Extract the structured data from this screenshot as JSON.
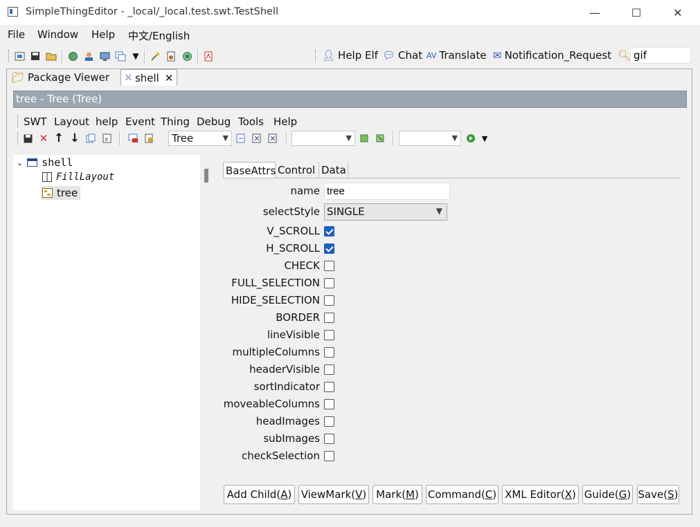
{
  "window": {
    "title": "SimpleThingEditor - _local/_local.test.swt.TestShell",
    "minimize": "—",
    "maximize": "☐",
    "close": "✕"
  },
  "menubar": [
    "File",
    "Window",
    "Help",
    "中文/English"
  ],
  "toolbar": {
    "links": [
      {
        "label": "Help Elf",
        "icon": "person-icon"
      },
      {
        "label": "Chat",
        "icon": "chat-icon"
      },
      {
        "label": "Translate",
        "icon": "translate-icon"
      },
      {
        "label": "Notification_Request",
        "icon": "mail-icon"
      }
    ],
    "search_value": "gif"
  },
  "view_tabs": {
    "package_viewer": "Package Viewer",
    "shell": "shell"
  },
  "header": "tree - Tree  (Tree)",
  "inner_menu": [
    "SWT",
    "Layout",
    "help",
    "Event",
    "Thing",
    "Debug",
    "Tools",
    "Help"
  ],
  "inner_toolbar": {
    "combo1": "Tree",
    "combo2": "",
    "combo3": ""
  },
  "tree": {
    "root": "shell",
    "layout": "FillLayout",
    "child": "tree"
  },
  "prop_tabs": [
    "BaseAttrs",
    "Control",
    "Data"
  ],
  "fields": {
    "name_label": "name",
    "name_value": "tree",
    "select_label": "selectStyle",
    "select_value": "SINGLE"
  },
  "checkboxes": [
    {
      "label": "V_SCROLL",
      "checked": true
    },
    {
      "label": "H_SCROLL",
      "checked": true
    },
    {
      "label": "CHECK",
      "checked": false
    },
    {
      "label": "FULL_SELECTION",
      "checked": false
    },
    {
      "label": "HIDE_SELECTION",
      "checked": false
    },
    {
      "label": "BORDER",
      "checked": false
    },
    {
      "label": "lineVisible",
      "checked": false
    },
    {
      "label": "multipleColumns",
      "checked": false
    },
    {
      "label": "headerVisible",
      "checked": false
    },
    {
      "label": "sortIndicator",
      "checked": false
    },
    {
      "label": "moveableColumns",
      "checked": false
    },
    {
      "label": "headImages",
      "checked": false
    },
    {
      "label": "subImages",
      "checked": false
    },
    {
      "label": "checkSelection",
      "checked": false
    }
  ],
  "buttons": [
    {
      "label": "Add Child",
      "key": "A"
    },
    {
      "label": "ViewMark",
      "key": "V"
    },
    {
      "label": "Mark",
      "key": "M"
    },
    {
      "label": "Command",
      "key": "C"
    },
    {
      "label": "XML Editor",
      "key": "X"
    },
    {
      "label": "Guide",
      "key": "G"
    },
    {
      "label": "Save",
      "key": "S"
    }
  ]
}
